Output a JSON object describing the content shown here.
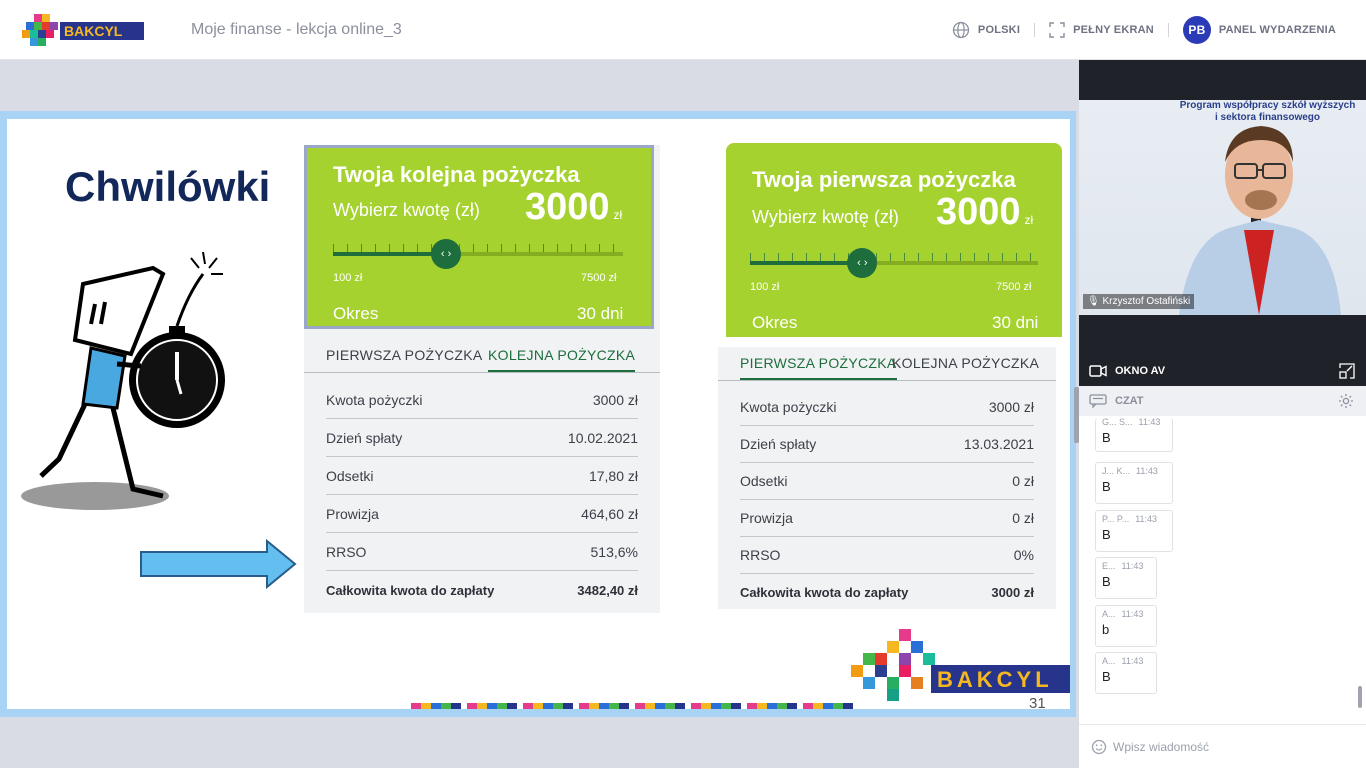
{
  "header": {
    "logo_text": "BAKCYL",
    "title": "Moje finanse - lekcja online_3",
    "actions": [
      {
        "label": "POLSKI",
        "icon": "globe-icon"
      },
      {
        "label": "PEŁNY EKRAN",
        "icon": "fullscreen-icon"
      },
      {
        "label": "PANEL WYDARZENIA",
        "icon": "avatar-badge",
        "badge": "PB"
      }
    ]
  },
  "slide": {
    "title": "Chwilówki",
    "page_number": "31",
    "footer_logo": "BAKCYL",
    "left_card": {
      "heading": "Twoja kolejna pożyczka",
      "pick_label": "Wybierz kwotę (zł)",
      "amount": "3000",
      "unit": "zł",
      "slider_min": "100 zł",
      "slider_max": "7500 zł",
      "slider_value_fraction": 0.39,
      "period_label": "Okres",
      "period_value": "30 dni",
      "tabs": [
        {
          "label": "PIERWSZA POŻYCZKA",
          "active": false
        },
        {
          "label": "KOLEJNA POŻYCZKA",
          "active": true
        }
      ],
      "rows": [
        {
          "label": "Kwota pożyczki",
          "value": "3000 zł"
        },
        {
          "label": "Dzień spłaty",
          "value": "10.02.2021"
        },
        {
          "label": "Odsetki",
          "value": "17,80 zł"
        },
        {
          "label": "Prowizja",
          "value": "464,60 zł"
        },
        {
          "label": "RRSO",
          "value": "513,6%"
        },
        {
          "label": "Całkowita kwota do zapłaty",
          "value": "3482,40 zł"
        }
      ]
    },
    "right_card": {
      "heading": "Twoja pierwsza pożyczka",
      "pick_label": "Wybierz kwotę (zł)",
      "amount": "3000",
      "unit": "zł",
      "slider_min": "100 zł",
      "slider_max": "7500 zł",
      "slider_value_fraction": 0.39,
      "period_label": "Okres",
      "period_value": "30 dni",
      "tabs": [
        {
          "label": "PIERWSZA POŻYCZKA",
          "active": true
        },
        {
          "label": "KOLEJNA POŻYCZKA",
          "active": false
        }
      ],
      "rows": [
        {
          "label": "Kwota pożyczki",
          "value": "3000 zł"
        },
        {
          "label": "Dzień spłaty",
          "value": "13.03.2021"
        },
        {
          "label": "Odsetki",
          "value": "0 zł"
        },
        {
          "label": "Prowizja",
          "value": "0 zł"
        },
        {
          "label": "RRSO",
          "value": "0%"
        },
        {
          "label": "Całkowita kwota do zapłaty",
          "value": "3000 zł"
        }
      ]
    }
  },
  "video": {
    "speaker_name": "Krzysztof Ostafiński",
    "banner_text_1": "Program współpracy szkół wyższych",
    "banner_text_2": "i sektora finansowego",
    "av_label": "OKNO AV"
  },
  "chat": {
    "label": "CZAT",
    "input_placeholder": "Wpisz wiadomość",
    "messages": [
      {
        "author": "G... S...",
        "time": "11:43",
        "text": "B"
      },
      {
        "author": "J... K...",
        "time": "11:43",
        "text": "B"
      },
      {
        "author": "P... P...",
        "time": "11:43",
        "text": "B"
      },
      {
        "author": "E...",
        "time": "11:43",
        "text": "B"
      },
      {
        "author": "A...",
        "time": "11:43",
        "text": "b"
      },
      {
        "author": "A...",
        "time": "11:43",
        "text": "B"
      }
    ]
  },
  "colors": {
    "accent_green": "#a6d22f",
    "dark_green": "#1d6e3c",
    "navy_title": "#13285a",
    "badge_blue": "#2b3bb8"
  }
}
